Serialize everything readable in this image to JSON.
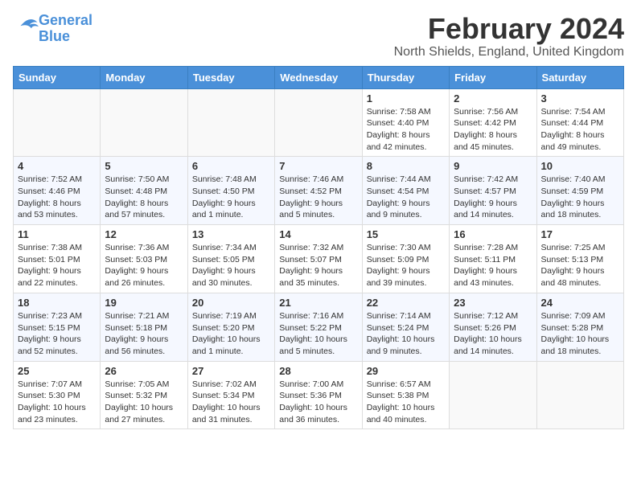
{
  "logo": {
    "line1": "General",
    "line2": "Blue"
  },
  "title": "February 2024",
  "subtitle": "North Shields, England, United Kingdom",
  "weekdays": [
    "Sunday",
    "Monday",
    "Tuesday",
    "Wednesday",
    "Thursday",
    "Friday",
    "Saturday"
  ],
  "weeks": [
    [
      {
        "day": "",
        "info": ""
      },
      {
        "day": "",
        "info": ""
      },
      {
        "day": "",
        "info": ""
      },
      {
        "day": "",
        "info": ""
      },
      {
        "day": "1",
        "info": "Sunrise: 7:58 AM\nSunset: 4:40 PM\nDaylight: 8 hours\nand 42 minutes."
      },
      {
        "day": "2",
        "info": "Sunrise: 7:56 AM\nSunset: 4:42 PM\nDaylight: 8 hours\nand 45 minutes."
      },
      {
        "day": "3",
        "info": "Sunrise: 7:54 AM\nSunset: 4:44 PM\nDaylight: 8 hours\nand 49 minutes."
      }
    ],
    [
      {
        "day": "4",
        "info": "Sunrise: 7:52 AM\nSunset: 4:46 PM\nDaylight: 8 hours\nand 53 minutes."
      },
      {
        "day": "5",
        "info": "Sunrise: 7:50 AM\nSunset: 4:48 PM\nDaylight: 8 hours\nand 57 minutes."
      },
      {
        "day": "6",
        "info": "Sunrise: 7:48 AM\nSunset: 4:50 PM\nDaylight: 9 hours\nand 1 minute."
      },
      {
        "day": "7",
        "info": "Sunrise: 7:46 AM\nSunset: 4:52 PM\nDaylight: 9 hours\nand 5 minutes."
      },
      {
        "day": "8",
        "info": "Sunrise: 7:44 AM\nSunset: 4:54 PM\nDaylight: 9 hours\nand 9 minutes."
      },
      {
        "day": "9",
        "info": "Sunrise: 7:42 AM\nSunset: 4:57 PM\nDaylight: 9 hours\nand 14 minutes."
      },
      {
        "day": "10",
        "info": "Sunrise: 7:40 AM\nSunset: 4:59 PM\nDaylight: 9 hours\nand 18 minutes."
      }
    ],
    [
      {
        "day": "11",
        "info": "Sunrise: 7:38 AM\nSunset: 5:01 PM\nDaylight: 9 hours\nand 22 minutes."
      },
      {
        "day": "12",
        "info": "Sunrise: 7:36 AM\nSunset: 5:03 PM\nDaylight: 9 hours\nand 26 minutes."
      },
      {
        "day": "13",
        "info": "Sunrise: 7:34 AM\nSunset: 5:05 PM\nDaylight: 9 hours\nand 30 minutes."
      },
      {
        "day": "14",
        "info": "Sunrise: 7:32 AM\nSunset: 5:07 PM\nDaylight: 9 hours\nand 35 minutes."
      },
      {
        "day": "15",
        "info": "Sunrise: 7:30 AM\nSunset: 5:09 PM\nDaylight: 9 hours\nand 39 minutes."
      },
      {
        "day": "16",
        "info": "Sunrise: 7:28 AM\nSunset: 5:11 PM\nDaylight: 9 hours\nand 43 minutes."
      },
      {
        "day": "17",
        "info": "Sunrise: 7:25 AM\nSunset: 5:13 PM\nDaylight: 9 hours\nand 48 minutes."
      }
    ],
    [
      {
        "day": "18",
        "info": "Sunrise: 7:23 AM\nSunset: 5:15 PM\nDaylight: 9 hours\nand 52 minutes."
      },
      {
        "day": "19",
        "info": "Sunrise: 7:21 AM\nSunset: 5:18 PM\nDaylight: 9 hours\nand 56 minutes."
      },
      {
        "day": "20",
        "info": "Sunrise: 7:19 AM\nSunset: 5:20 PM\nDaylight: 10 hours\nand 1 minute."
      },
      {
        "day": "21",
        "info": "Sunrise: 7:16 AM\nSunset: 5:22 PM\nDaylight: 10 hours\nand 5 minutes."
      },
      {
        "day": "22",
        "info": "Sunrise: 7:14 AM\nSunset: 5:24 PM\nDaylight: 10 hours\nand 9 minutes."
      },
      {
        "day": "23",
        "info": "Sunrise: 7:12 AM\nSunset: 5:26 PM\nDaylight: 10 hours\nand 14 minutes."
      },
      {
        "day": "24",
        "info": "Sunrise: 7:09 AM\nSunset: 5:28 PM\nDaylight: 10 hours\nand 18 minutes."
      }
    ],
    [
      {
        "day": "25",
        "info": "Sunrise: 7:07 AM\nSunset: 5:30 PM\nDaylight: 10 hours\nand 23 minutes."
      },
      {
        "day": "26",
        "info": "Sunrise: 7:05 AM\nSunset: 5:32 PM\nDaylight: 10 hours\nand 27 minutes."
      },
      {
        "day": "27",
        "info": "Sunrise: 7:02 AM\nSunset: 5:34 PM\nDaylight: 10 hours\nand 31 minutes."
      },
      {
        "day": "28",
        "info": "Sunrise: 7:00 AM\nSunset: 5:36 PM\nDaylight: 10 hours\nand 36 minutes."
      },
      {
        "day": "29",
        "info": "Sunrise: 6:57 AM\nSunset: 5:38 PM\nDaylight: 10 hours\nand 40 minutes."
      },
      {
        "day": "",
        "info": ""
      },
      {
        "day": "",
        "info": ""
      }
    ]
  ]
}
